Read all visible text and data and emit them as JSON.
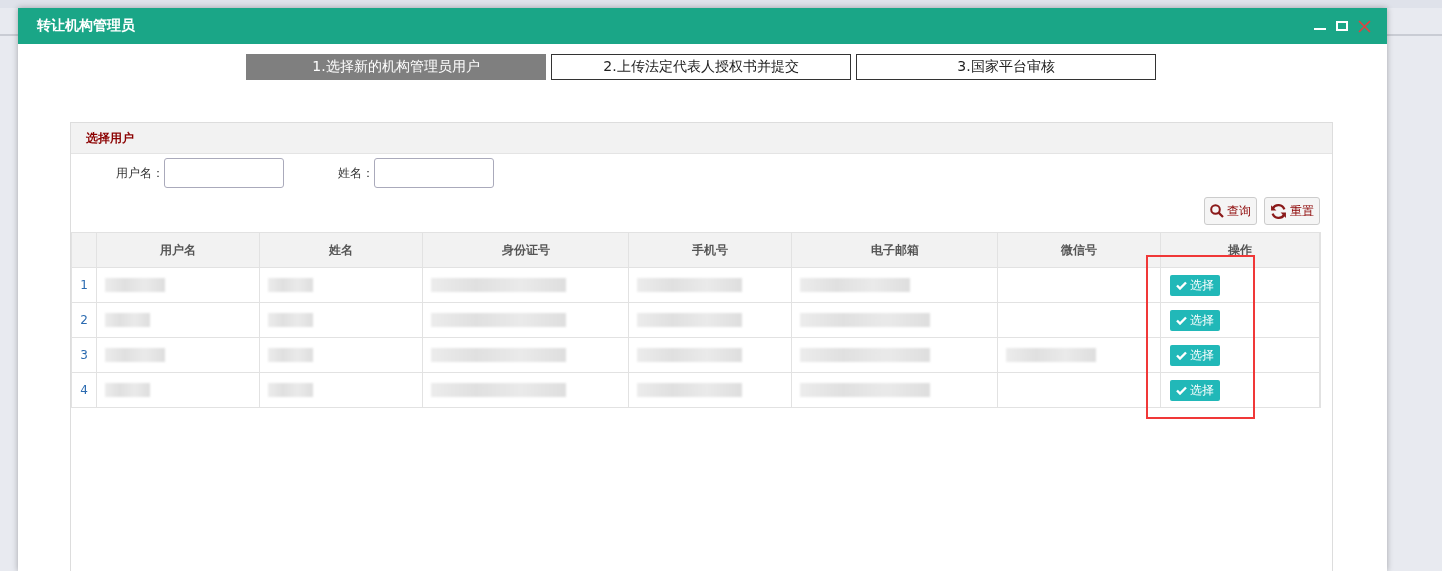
{
  "dialog": {
    "title": "转让机构管理员",
    "steps": [
      {
        "label": "1.选择新的机构管理员用户",
        "selected": true
      },
      {
        "label": "2.上传法定代表人授权书并提交",
        "selected": false
      },
      {
        "label": "3.国家平台审核",
        "selected": false
      }
    ],
    "panel": {
      "title": "选择用户",
      "filters": [
        {
          "label": "用户名："
        },
        {
          "label": "姓名："
        }
      ],
      "buttons": [
        {
          "label": "查询",
          "kind": "search"
        },
        {
          "label": "重置",
          "kind": "reset"
        }
      ],
      "table": {
        "columns": [
          "用户名",
          "姓名",
          "身份证号",
          "手机号",
          "电子邮箱",
          "微信号",
          "操作"
        ],
        "rows": [
          {
            "number": "1",
            "action": "选择"
          },
          {
            "number": "2",
            "action": "选择"
          },
          {
            "number": "3",
            "action": "选择"
          },
          {
            "number": "4",
            "action": "选择"
          }
        ]
      }
    }
  }
}
